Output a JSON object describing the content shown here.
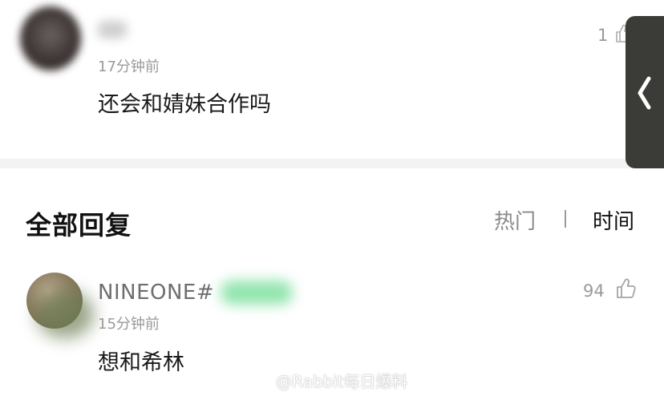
{
  "top_comment": {
    "time": "17分钟前",
    "text": "还会和婧妹合作吗",
    "likes": "1"
  },
  "replies": {
    "title": "全部回复",
    "sort_hot": "热门",
    "sort_divider": "|",
    "sort_time": "时间",
    "items": [
      {
        "name": "NINEONE#",
        "time": "15分钟前",
        "text": "想和希林",
        "likes": "94"
      }
    ]
  },
  "watermark": "@Rabbit每日爆料",
  "icons": {
    "like": "thumbs-up-icon",
    "back": "chevron-left-icon",
    "weibo": "weibo-logo-icon"
  },
  "colors": {
    "background": "#f3f3f3",
    "card": "#ffffff",
    "primary_text": "#111111",
    "secondary_text": "#9a9a9a",
    "handle": "#3b3c38"
  }
}
